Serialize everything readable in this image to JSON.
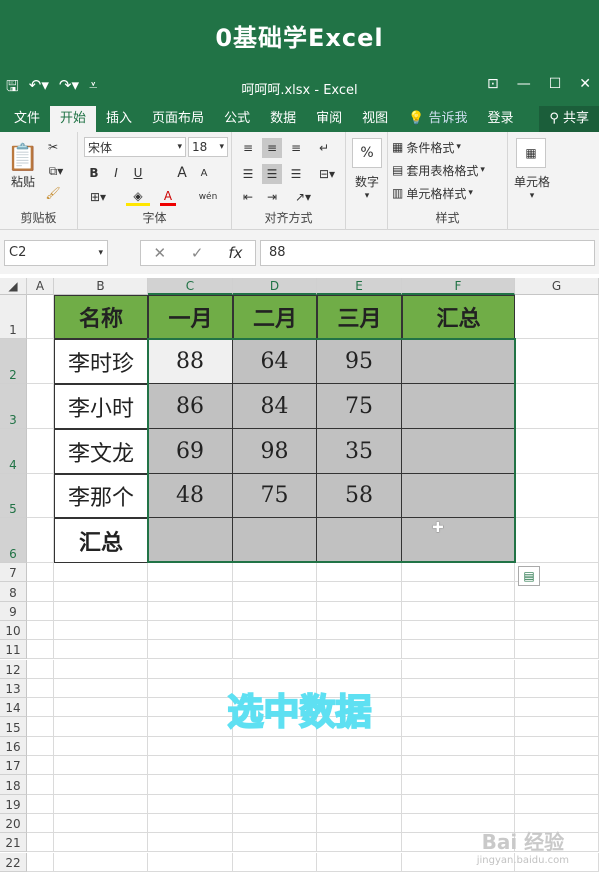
{
  "video_title": "0基础学Excel",
  "window": {
    "filename": "呵呵呵.xlsx - Excel",
    "qat": [
      "save-icon",
      "undo-icon",
      "redo-icon",
      "customize-icon"
    ],
    "controls": [
      "ribbon-display-icon",
      "minimize-icon",
      "maximize-icon",
      "close-icon"
    ]
  },
  "tabs": [
    "文件",
    "开始",
    "插入",
    "页面布局",
    "公式",
    "数据",
    "审阅",
    "视图"
  ],
  "active_tab": "开始",
  "tell_me": "告诉我",
  "login": "登录",
  "share": "共享",
  "ribbon": {
    "clipboard": {
      "label": "剪贴板",
      "paste": "粘贴"
    },
    "font": {
      "label": "字体",
      "name": "宋体",
      "size": "18",
      "bold": "B",
      "italic": "I",
      "underline": "U",
      "grow": "A",
      "shrink": "A",
      "font_color": "A",
      "wen": "wén"
    },
    "alignment": {
      "label": "对齐方式"
    },
    "number": {
      "label": "数字",
      "percent": "%"
    },
    "styles": {
      "label": "样式",
      "conditional": "条件格式",
      "table": "套用表格格式",
      "cell": "单元格样式"
    },
    "cells": {
      "label": "单元格"
    }
  },
  "formula_bar": {
    "name_box": "C2",
    "cancel": "✕",
    "enter": "✓",
    "fx": "fx",
    "value": "88"
  },
  "columns": [
    "A",
    "B",
    "C",
    "D",
    "E",
    "F",
    "G"
  ],
  "rows": [
    "1",
    "2",
    "3",
    "4",
    "5",
    "6",
    "7",
    "8",
    "9",
    "10",
    "11",
    "12",
    "13",
    "14",
    "15",
    "16",
    "17",
    "18",
    "19",
    "20",
    "21",
    "22"
  ],
  "table": {
    "headers": [
      "名称",
      "一月",
      "二月",
      "三月",
      "汇总"
    ],
    "rows": [
      {
        "name": "李时珍",
        "values": [
          "88",
          "64",
          "95",
          ""
        ]
      },
      {
        "name": "李小时",
        "values": [
          "86",
          "84",
          "75",
          ""
        ]
      },
      {
        "name": "李文龙",
        "values": [
          "69",
          "98",
          "35",
          ""
        ]
      },
      {
        "name": "李那个",
        "values": [
          "48",
          "75",
          "58",
          ""
        ]
      },
      {
        "name": "汇总",
        "values": [
          "",
          "",
          "",
          ""
        ]
      }
    ]
  },
  "caption": "选中数据",
  "watermark": {
    "line1": "Bai 经验",
    "line2": "jingyan.baidu.com"
  }
}
